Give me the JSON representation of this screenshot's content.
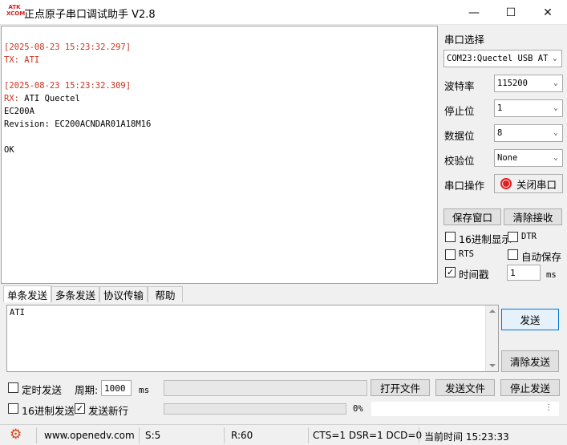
{
  "window": {
    "logo_lines": [
      "ATK",
      "XCOM"
    ],
    "title": "正点原子串口调试助手 V2.8",
    "minimize": "—",
    "maximize": "☐",
    "close": "✕"
  },
  "receive": {
    "lines": [
      {
        "text": "[2025-08-23 15:23:32.297]",
        "color": "#c8321e"
      },
      {
        "text": "TX: ATI",
        "color": "#c8321e"
      },
      {
        "text": "",
        "color": "#000000"
      },
      {
        "text": "[2025-08-23 15:23:32.309]",
        "color": "#c8321e"
      },
      {
        "prefix": "RX:",
        "text": " ATI Quectel",
        "color": "#000000"
      },
      {
        "text": "EC200A",
        "color": "#000000"
      },
      {
        "text": "Revision: EC200ACNDAR01A18M16",
        "color": "#000000"
      },
      {
        "text": "",
        "color": "#000000"
      },
      {
        "text": "OK",
        "color": "#000000"
      }
    ]
  },
  "panel": {
    "port_select_label": "串口选择",
    "port_value": "COM23:Quectel USB AT",
    "baud_label": "波特率",
    "baud_value": "115200",
    "stop_label": "停止位",
    "stop_value": "1",
    "data_label": "数据位",
    "data_value": "8",
    "parity_label": "校验位",
    "parity_value": "None",
    "port_op_label": "串口操作",
    "close_port_button": "关闭串口",
    "save_window_button": "保存窗口",
    "clear_recv_button": "清除接收",
    "hex_display": {
      "label": "16进制显示",
      "checked": false
    },
    "dtr": {
      "label": "DTR",
      "checked": false
    },
    "rts": {
      "label": "RTS",
      "checked": false
    },
    "auto_save": {
      "label": "自动保存",
      "checked": false
    },
    "timestamp": {
      "label": "时间戳",
      "checked": true
    },
    "timestamp_ms": "1",
    "timestamp_unit": "ms"
  },
  "tabs": [
    "单条发送",
    "多条发送",
    "协议传输",
    "帮助"
  ],
  "send": {
    "text": "ATI",
    "send_button": "发送",
    "clear_send_button": "清除发送",
    "timed_send": {
      "label": "定时发送",
      "checked": false
    },
    "period_label": "周期:",
    "period_value": "1000",
    "period_unit": "ms",
    "open_file_button": "打开文件",
    "send_file_button": "发送文件",
    "stop_send_button": "停止发送",
    "hex_send": {
      "label": "16进制发送",
      "checked": false
    },
    "newline": {
      "label": "发送新行",
      "checked": true
    },
    "progress_text": "0%",
    "progress": 0
  },
  "status": {
    "website": "www.openedv.com",
    "sent": "S:5",
    "received": "R:60",
    "signals": "CTS=1 DSR=1 DCD=0",
    "time": "当前时间 15:23:33"
  },
  "colors": {
    "accent_red": "#c8321e",
    "close_port_icon": "#e41e1e",
    "gear_icon": "#d9441c"
  }
}
